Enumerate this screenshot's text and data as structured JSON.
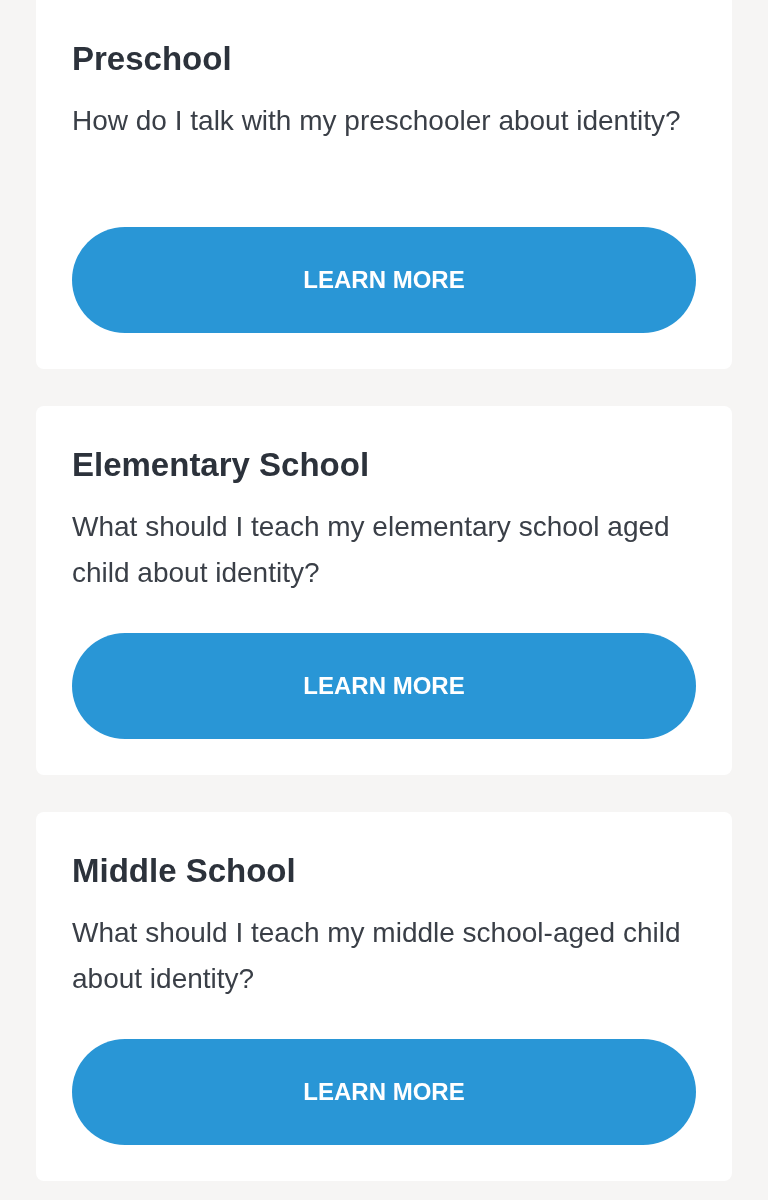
{
  "cards": [
    {
      "title": "Preschool",
      "question": "How do I talk with my preschooler about identity?",
      "button": "LEARN MORE"
    },
    {
      "title": "Elementary School",
      "question": "What should I teach my elementary school aged child about identity?",
      "button": "LEARN MORE"
    },
    {
      "title": "Middle School",
      "question": "What should I teach my middle school-aged child about identity?",
      "button": "LEARN MORE"
    }
  ]
}
